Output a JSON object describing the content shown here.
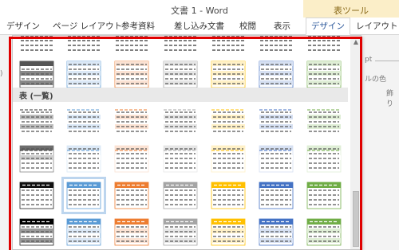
{
  "window": {
    "title": "文書 1 - Word"
  },
  "context": {
    "label": "表ツール"
  },
  "tabs": [
    "デザイン",
    "ページ レイアウト",
    "参考資料",
    "差し込み文書",
    "校閲",
    "表示",
    "デザイン",
    "レイアウト"
  ],
  "ribbon_fragments": {
    "pt": "pt",
    "shading": "ルの色",
    "border": "飾り"
  },
  "gallery": {
    "section_title": "表 (一覧)",
    "colors": {
      "black": "#3a3a3a",
      "blue": "#5b9bd5",
      "orange": "#ed7d31",
      "gray": "#a5a5a5",
      "gold": "#ffc000",
      "navy": "#4472c4",
      "green": "#70ad47"
    },
    "rows": [
      {
        "style": "plain-banded"
      },
      {
        "style": "banded-top"
      },
      {
        "style": "banded-light"
      },
      {
        "style": "grid-light"
      },
      {
        "style": "header-fill"
      },
      {
        "style": "header-fill-dark"
      }
    ],
    "selected": {
      "row": 4,
      "col": 1
    }
  },
  "scrollbar": {
    "up_arrow": "▲"
  }
}
